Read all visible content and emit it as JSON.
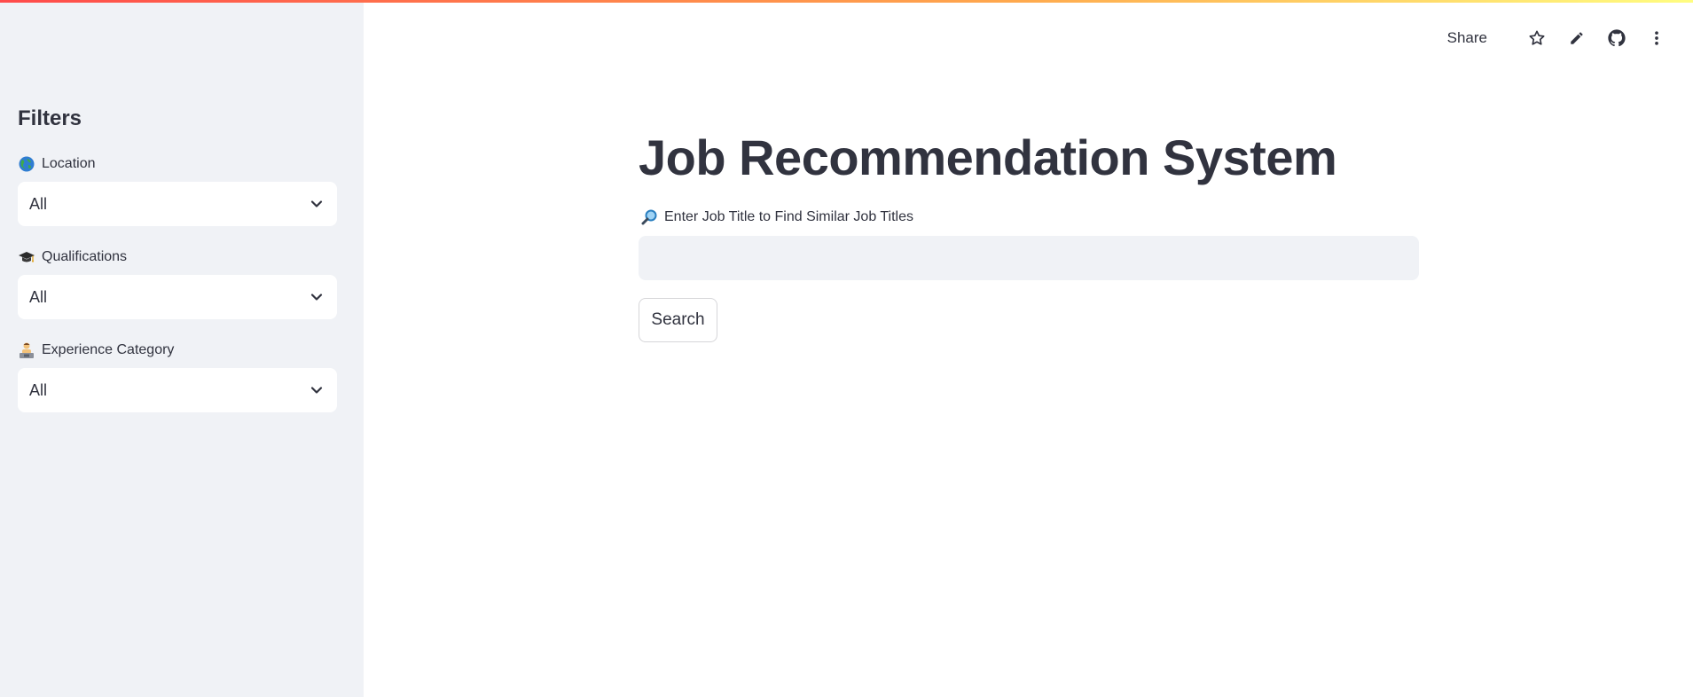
{
  "app": {
    "title": "Job Recommendation System"
  },
  "colors": {
    "accent": "#ff4b4b",
    "sidebar_bg": "#f0f2f6",
    "text": "#31333f"
  },
  "toolbar": {
    "share_label": "Share",
    "icons": [
      "star-icon",
      "pencil-icon",
      "github-icon",
      "more-vertical-icon"
    ]
  },
  "sidebar": {
    "title": "Filters",
    "filters": [
      {
        "icon": "globe-icon",
        "label": "Location",
        "selected": "All"
      },
      {
        "icon": "graduation-cap-icon",
        "label": "Qualifications",
        "selected": "All"
      },
      {
        "icon": "office-worker-icon",
        "label": "Experience Category",
        "selected": "All"
      }
    ]
  },
  "main": {
    "search_label": "Enter Job Title to Find Similar Job Titles",
    "search_icon": "magnifier-icon",
    "search_value": "",
    "search_button": "Search"
  }
}
